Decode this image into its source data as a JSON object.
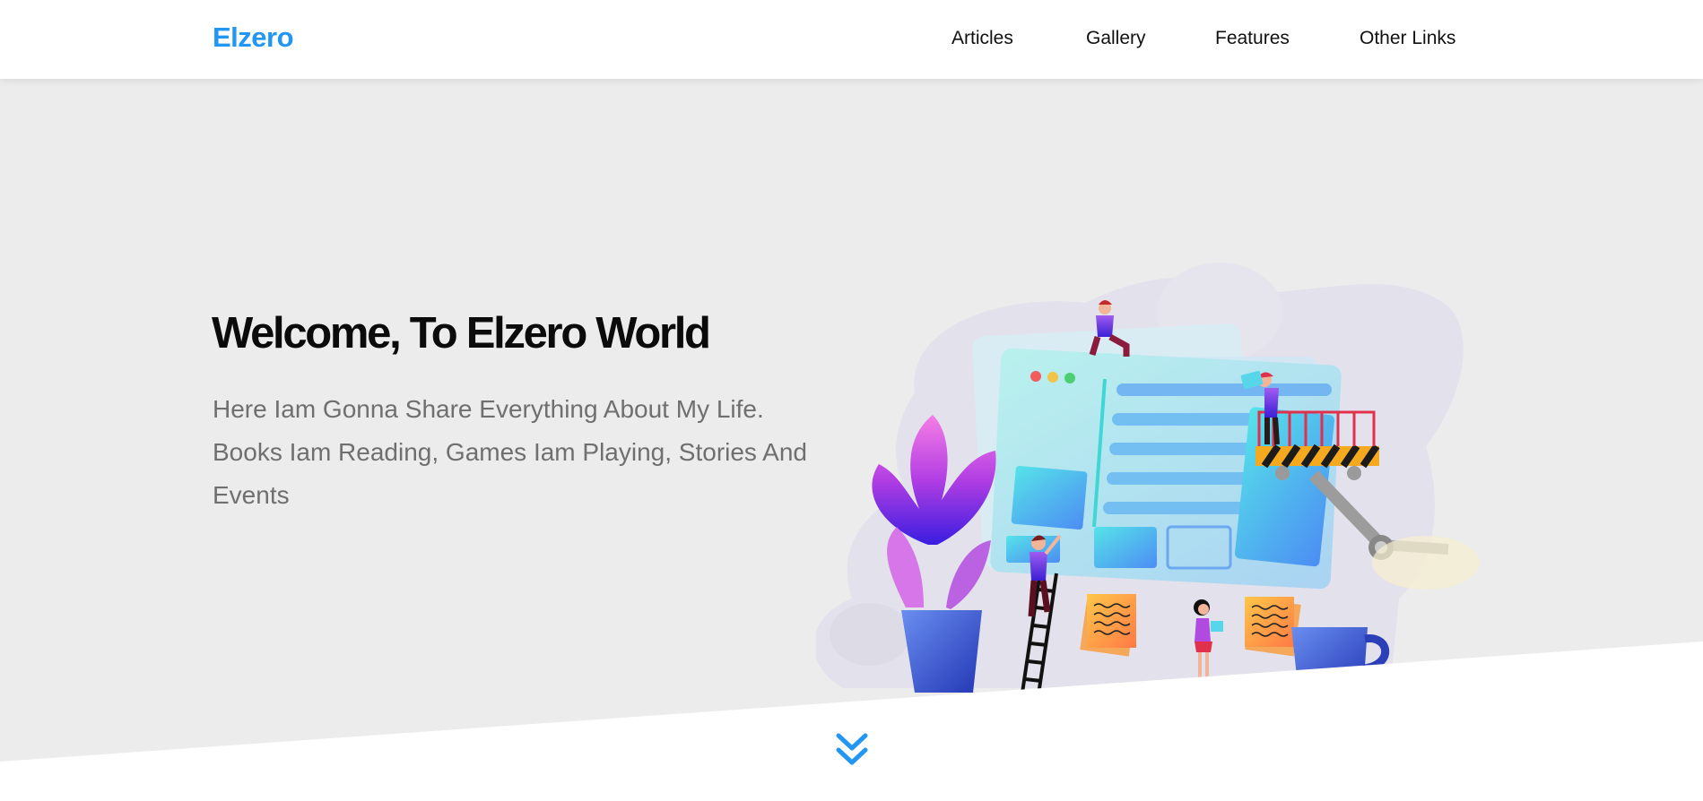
{
  "header": {
    "logo": "Elzero",
    "nav": [
      "Articles",
      "Gallery",
      "Features",
      "Other Links"
    ]
  },
  "hero": {
    "title": "Welcome, To Elzero World",
    "description": "Here Iam Gonna Share Everything About My Life. Books Iam Reading, Games Iam Playing, Stories And Events",
    "illustration": "landing-illustration"
  },
  "scroll": {
    "icon": "double-chevron-down-icon"
  },
  "colors": {
    "accent": "#2196f3",
    "hero_background": "#ececec",
    "title": "#0b0b0b",
    "text": "#6f6f6f"
  }
}
